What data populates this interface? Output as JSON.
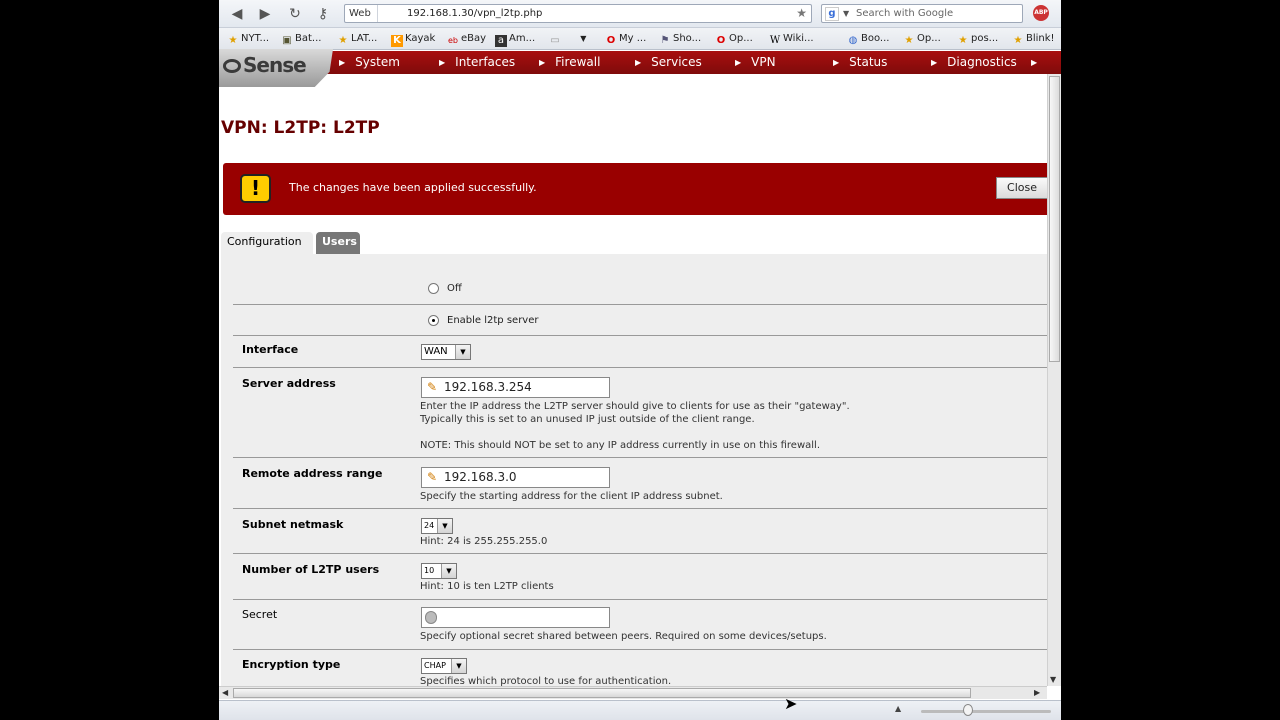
{
  "browser": {
    "url_prefix": "Web",
    "url": "192.168.1.30/vpn_l2tp.php",
    "search_placeholder": "Search with Google",
    "abp_label": "ABP",
    "bookmarks": [
      {
        "label": "NYT...",
        "icon": "star"
      },
      {
        "label": "Bat...",
        "icon": "tv"
      },
      {
        "label": "LAT...",
        "icon": "star"
      },
      {
        "label": "Kayak",
        "icon": "k"
      },
      {
        "label": "eBay",
        "icon": "ebay"
      },
      {
        "label": "Am...",
        "icon": "a"
      },
      {
        "label": "",
        "icon": "folder"
      },
      {
        "label": "My ...",
        "icon": "opera"
      },
      {
        "label": "Sho...",
        "icon": "tag"
      },
      {
        "label": "Op...",
        "icon": "opera"
      },
      {
        "label": "Wiki...",
        "icon": "w"
      },
      {
        "label": "Boo...",
        "icon": "globe"
      },
      {
        "label": "Op...",
        "icon": "star"
      },
      {
        "label": "pos...",
        "icon": "star"
      },
      {
        "label": "Blink!",
        "icon": "star"
      }
    ]
  },
  "pfsense": {
    "logo_text": "Sense",
    "menu": [
      "System",
      "Interfaces",
      "Firewall",
      "Services",
      "VPN",
      "Status",
      "Diagnostics"
    ]
  },
  "page": {
    "title": "VPN: L2TP: L2TP",
    "notice": "The changes have been applied successfully.",
    "close_label": "Close",
    "tabs": [
      "Configuration",
      "Users"
    ]
  },
  "form": {
    "radio_off": "Off",
    "radio_enable": "Enable l2tp server",
    "interface": {
      "label": "Interface",
      "value": "WAN"
    },
    "server_address": {
      "label": "Server address",
      "value": "192.168.3.254",
      "help1": "Enter the IP address the L2TP server should give to clients for use as their \"gateway\".",
      "help2": "Typically this is set to an unused IP just outside of the client range.",
      "note": "NOTE: This should NOT be set to any IP address currently in use on this firewall."
    },
    "remote_range": {
      "label": "Remote address range",
      "value": "192.168.3.0",
      "help": "Specify the starting address for the client IP address subnet."
    },
    "netmask": {
      "label": "Subnet netmask",
      "value": "24",
      "hint": "Hint: 24 is 255.255.255.0"
    },
    "users": {
      "label": "Number of L2TP users",
      "value": "10",
      "hint": "Hint: 10 is ten L2TP clients"
    },
    "secret": {
      "label": "Secret",
      "value": "",
      "help": "Specify optional secret shared between peers. Required on some devices/setups."
    },
    "encryption": {
      "label": "Encryption type",
      "value": "CHAP",
      "help": "Specifies which protocol to use for authentication."
    }
  }
}
